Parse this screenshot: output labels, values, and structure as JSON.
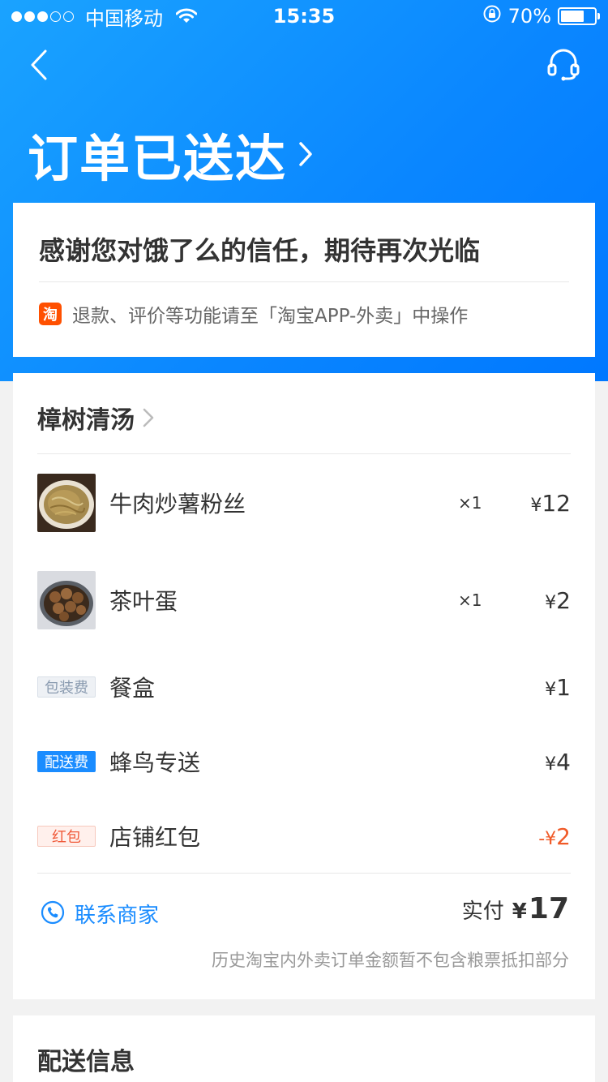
{
  "status_bar": {
    "carrier": "中国移动",
    "time": "15:35",
    "battery": "70%",
    "battery_level": 0.7,
    "signal_bars_filled": 3,
    "signal_bars_total": 5
  },
  "header": {
    "order_status": "订单已送达",
    "back_icon": "chevron-left-icon",
    "service_icon": "headset-icon"
  },
  "thanks_card": {
    "message": "感谢您对饿了么的信任，期待再次光临",
    "taobao_badge": "淘",
    "notice": "退款、评价等功能请至「淘宝APP-外卖」中操作"
  },
  "order": {
    "shop_name": "樟树清汤",
    "items": [
      {
        "name": "牛肉炒薯粉丝",
        "qty": "×1",
        "price_symbol": "¥",
        "price": "12"
      },
      {
        "name": "茶叶蛋",
        "qty": "×1",
        "price_symbol": "¥",
        "price": "2"
      }
    ],
    "fees": [
      {
        "tag": "包装费",
        "name": "餐盒",
        "price_symbol": "¥",
        "price": "1"
      },
      {
        "tag": "配送费",
        "name": "蜂鸟专送",
        "price_symbol": "¥",
        "price": "4"
      },
      {
        "tag": "红包",
        "name": "店铺红包",
        "price_symbol": "-¥",
        "price": "2"
      }
    ],
    "contact_label": "联系商家",
    "total_label": "实付",
    "total_symbol": "¥",
    "total_value": "17",
    "footnote": "历史淘宝内外卖订单金额暂不包含粮票抵扣部分"
  },
  "delivery": {
    "title": "配送信息"
  },
  "colors": {
    "header_blue": "#0a86ff",
    "link_blue": "#1a8cff",
    "discount_red": "#f05a28",
    "taobao_orange": "#ff5000"
  }
}
